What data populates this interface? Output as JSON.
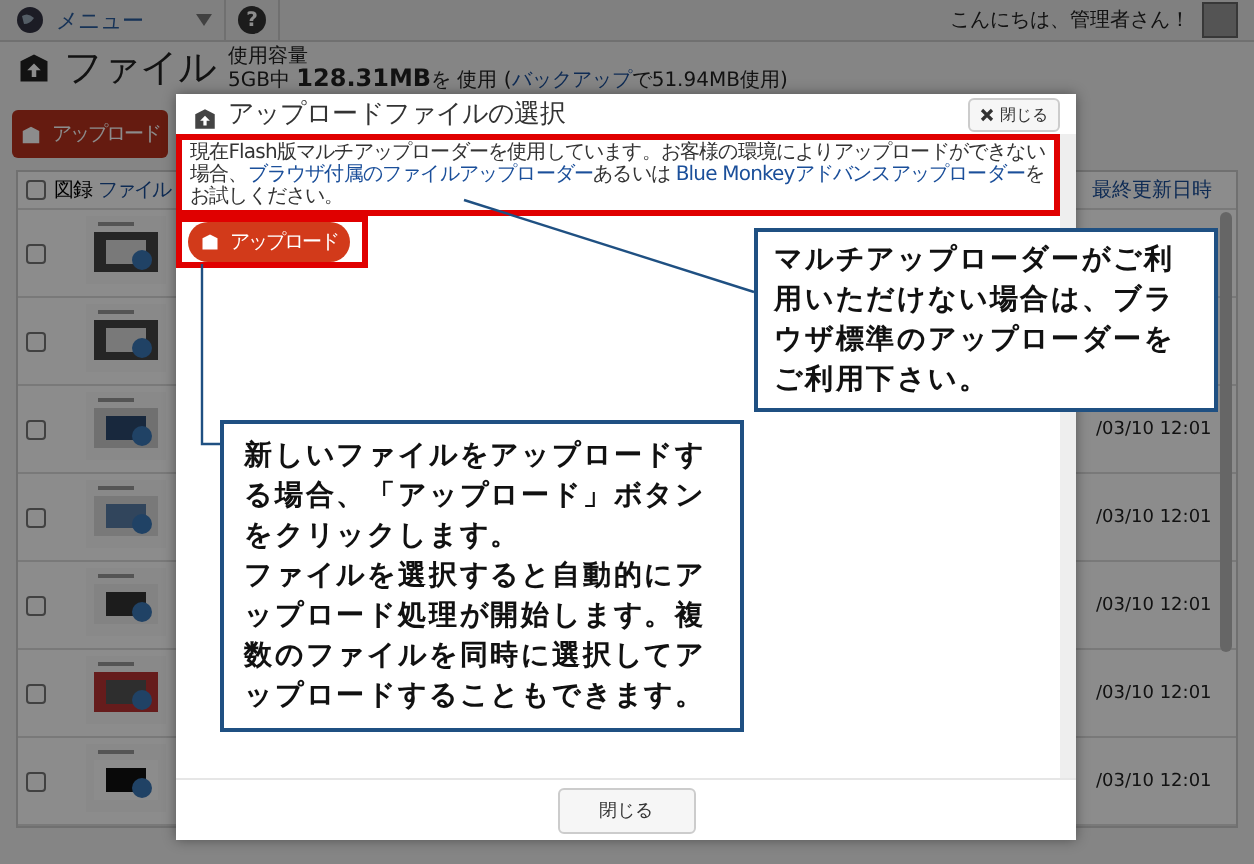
{
  "top_bar": {
    "menu_label": "メニュー",
    "help_glyph": "?",
    "greeting": "こんにちは、管理者さん！"
  },
  "page": {
    "title": "ファイル",
    "usage_label": "使用容量",
    "usage_text": "5GB中 **128.31MB**を 使用 (",
    "backup_link": "バックアップ",
    "usage_tail": "で51.94MB使用)",
    "upload_button": "アップロード"
  },
  "table": {
    "select_all_checked": false,
    "columns": [
      "図録",
      "ファイル",
      "最終更新日時"
    ],
    "rows": [
      {
        "checked": false
      },
      {
        "checked": false
      },
      {
        "checked": false,
        "updated": "/03/10 12:01"
      },
      {
        "checked": false,
        "updated": "/03/10 12:01"
      },
      {
        "checked": false,
        "updated": "/03/10 12:01"
      },
      {
        "checked": false,
        "updated": "/03/10 12:01"
      },
      {
        "checked": false,
        "updated": "/03/10 12:01"
      }
    ]
  },
  "dialog": {
    "title": "アップロードファイルの選択",
    "close_label": "閉じる",
    "notice": [
      {
        "kind": "text",
        "text": "現在Flash版マルチアップローダーを使用しています。お客様の環境によりアップロードができない場合、"
      },
      {
        "kind": "link",
        "text": "ブラウザ付属のファイルアップローダー"
      },
      {
        "kind": "text",
        "text": "あるいは "
      },
      {
        "kind": "link",
        "text": "Blue Monkeyアドバンスアップローダー"
      },
      {
        "kind": "text",
        "text": "をお試しください。"
      }
    ],
    "upload_button": "アップロード",
    "footer_button": "閉じる"
  },
  "callouts": [
    {
      "paragraphs": [
        "マルチアップローダーがご利用いただけない場合は、ブラウザ標準のアップローダーをご利用下さい。"
      ]
    },
    {
      "paragraphs": [
        "新しいファイルをアップロードする場合、「アップロード」ボタンをクリックします。",
        "ファイルを選択すると自動的にアップロード処理が開始します。複数のファイルを同時に選択してアップロードすることもできます。"
      ]
    }
  ]
}
